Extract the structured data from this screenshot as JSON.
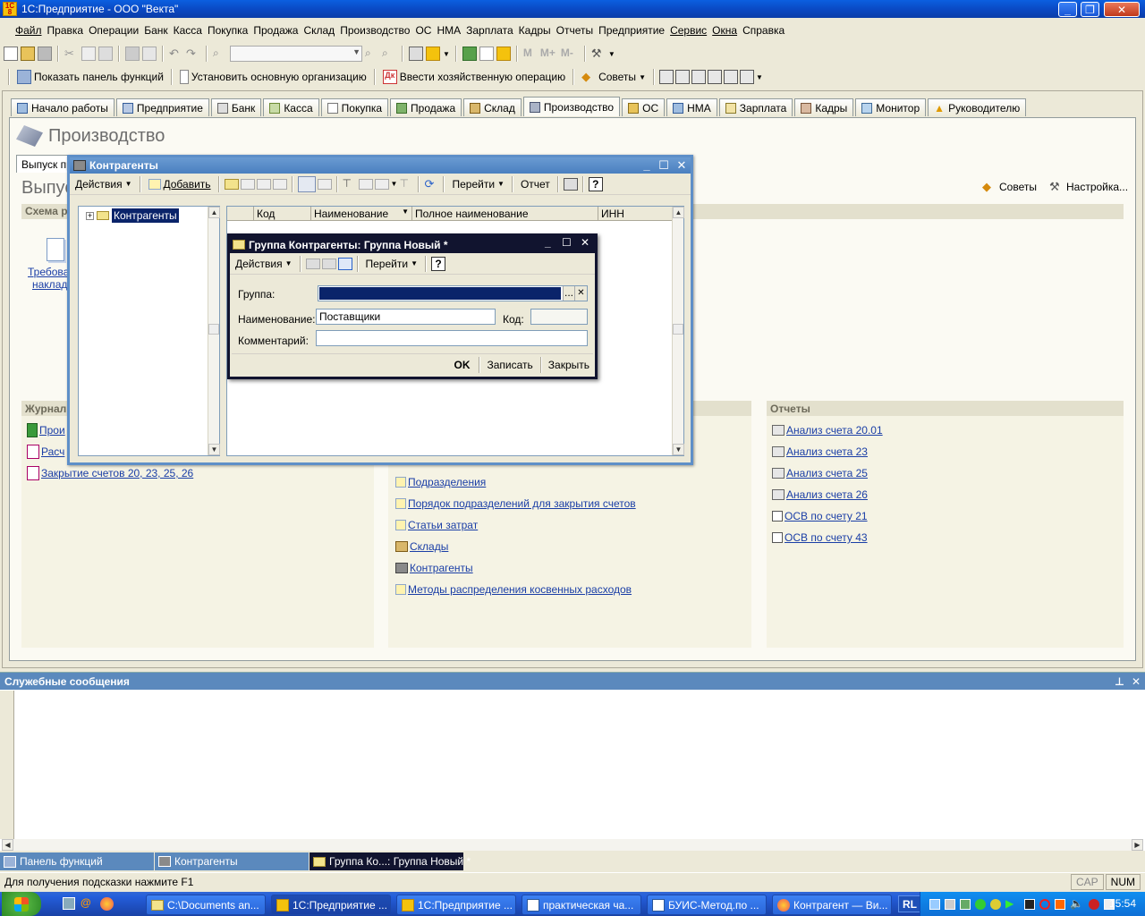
{
  "app": {
    "title": "1С:Предприятие - ООО \"Векта\"",
    "colors": {
      "xp_blue": "#0a48c2",
      "link": "#1a3ea6",
      "panel": "#f5f3e4"
    }
  },
  "menu": [
    "Файл",
    "Правка",
    "Операции",
    "Банк",
    "Касса",
    "Покупка",
    "Продажа",
    "Склад",
    "Производство",
    "ОС",
    "НМА",
    "Зарплата",
    "Кадры",
    "Отчеты",
    "Предприятие",
    "Сервис",
    "Окна",
    "Справка"
  ],
  "toolbar2": {
    "show_panel": "Показать панель функций",
    "set_org": "Установить основную организацию",
    "enter_op": "Ввести хозяйственную операцию",
    "tips": "Советы"
  },
  "tabs": [
    "Начало работы",
    "Предприятие",
    "Банк",
    "Касса",
    "Покупка",
    "Продажа",
    "Склад",
    "Производство",
    "ОС",
    "НМА",
    "Зарплата",
    "Кадры",
    "Монитор",
    "Руководителю"
  ],
  "active_tab": "Производство",
  "page": {
    "title": "Производство",
    "subtab": "Выпуск пр",
    "heading": "Выпус",
    "scheme_header": "Схема р",
    "scheme_item_1": "Требова",
    "scheme_item_2": "наклад",
    "tips": "Советы",
    "settings": "Настройка...",
    "journals_header": "Журнал",
    "journals": [
      "Прои",
      "Расч",
      "Закрытие счетов 20, 23, 25, 26"
    ],
    "refs": [
      "Подразделения",
      "Порядок подразделений для закрытия счетов",
      "Статьи затрат",
      "Склады",
      "Контрагенты",
      "Методы распределения косвенных расходов"
    ],
    "reports_header": "Отчеты",
    "reports": [
      "Анализ счета 20.01",
      "Анализ счета 23",
      "Анализ счета 25",
      "Анализ счета 26",
      "ОСВ по счету 21",
      "ОСВ по счету 43"
    ]
  },
  "kontragenty": {
    "title": "Контрагенты",
    "actions": "Действия",
    "add": "Добавить",
    "goto": "Перейти",
    "report": "Отчет",
    "tree_root": "Контрагенты",
    "columns": [
      "Код",
      "Наименование",
      "Полное наименование",
      "ИНН"
    ]
  },
  "group_dialog": {
    "title": "Группа Контрагенты: Группа Новый *",
    "actions": "Действия",
    "goto": "Перейти",
    "group_label": "Группа:",
    "group_value": "",
    "name_label": "Наименование:",
    "name_value": "Поставщики",
    "code_label": "Код:",
    "code_value": "",
    "comment_label": "Комментарий:",
    "comment_value": "",
    "ok": "OK",
    "save": "Записать",
    "close": "Закрыть"
  },
  "messages": {
    "title": "Служебные сообщения"
  },
  "window_tabs": [
    "Панель функций",
    "Контрагенты",
    "Группа Ко...: Группа Новый *"
  ],
  "status": {
    "hint": "Для получения подсказки нажмите F1",
    "cap": "CAP",
    "num": "NUM"
  },
  "taskbar": {
    "items": [
      "C:\\Documents an...",
      "1С:Предприятие ...",
      "1С:Предприятие ...",
      "практическая ча...",
      "БУИС-Метод.по ...",
      "Контрагент — Ви..."
    ],
    "lang": "RL",
    "time": "15:54"
  }
}
